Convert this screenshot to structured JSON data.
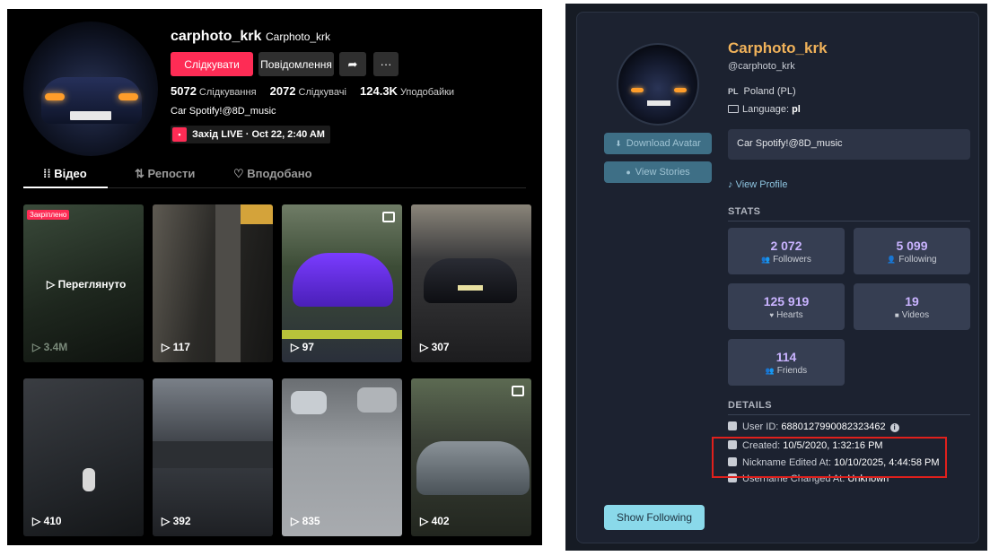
{
  "tiktok": {
    "username": "carphoto_krk",
    "nickname": "Carphoto_krk",
    "follow_label": "Слідкувати",
    "message_label": "Повідомлення",
    "share_icon": "share-arrow-icon",
    "more_label": "···",
    "stats": [
      {
        "value": "5072",
        "label": "Слідкування"
      },
      {
        "value": "2072",
        "label": "Слідкувачі"
      },
      {
        "value": "124.3K",
        "label": "Уподобайки"
      }
    ],
    "bio": "Car Spotify!@8D_music",
    "live_event": "Захід LIVE · Oct 22, 2:40 AM",
    "tabs": [
      {
        "label": "Відео",
        "icon": "⁞⁞"
      },
      {
        "label": "Репости",
        "icon": "⇅"
      },
      {
        "label": "Вподобано",
        "icon": "♡"
      }
    ],
    "pinned_badge": "Закріплено",
    "watched_label": "▷ Переглянуто",
    "videos": [
      {
        "views": "▷ 3.4M"
      },
      {
        "views": "▷ 117"
      },
      {
        "views": "▷ 97"
      },
      {
        "views": "▷ 307"
      },
      {
        "views": "▷ 410"
      },
      {
        "views": "▷ 392"
      },
      {
        "views": "▷ 835"
      },
      {
        "views": "▷ 402"
      }
    ]
  },
  "profile_viewer": {
    "display_name": "Carphoto_krk",
    "handle": "@carphoto_krk",
    "country_code": "PL",
    "country": "Poland (PL)",
    "language_label": "Language:",
    "language": "pl",
    "download_avatar_label": "Download Avatar",
    "view_stories_label": "View Stories",
    "bio": "Car Spotify!@8D_music",
    "view_profile_label": "View Profile",
    "stats_title": "STATS",
    "stats": [
      {
        "value": "2 072",
        "label": "Followers"
      },
      {
        "value": "5 099",
        "label": "Following"
      },
      {
        "value": "125 919",
        "label": "Hearts"
      },
      {
        "value": "19",
        "label": "Videos"
      },
      {
        "value": "114",
        "label": "Friends"
      }
    ],
    "details_title": "DETAILS",
    "details": {
      "user_id_label": "User ID:",
      "user_id": "6880127990082323462",
      "created_label": "Created:",
      "created": "10/5/2020, 1:32:16 PM",
      "nickname_edited_label": "Nickname Edited At:",
      "nickname_edited": "10/10/2025, 4:44:58 PM",
      "username_changed_label": "Username Changed At:",
      "username_changed": "Unknown"
    },
    "show_following_label": "Show Following"
  }
}
